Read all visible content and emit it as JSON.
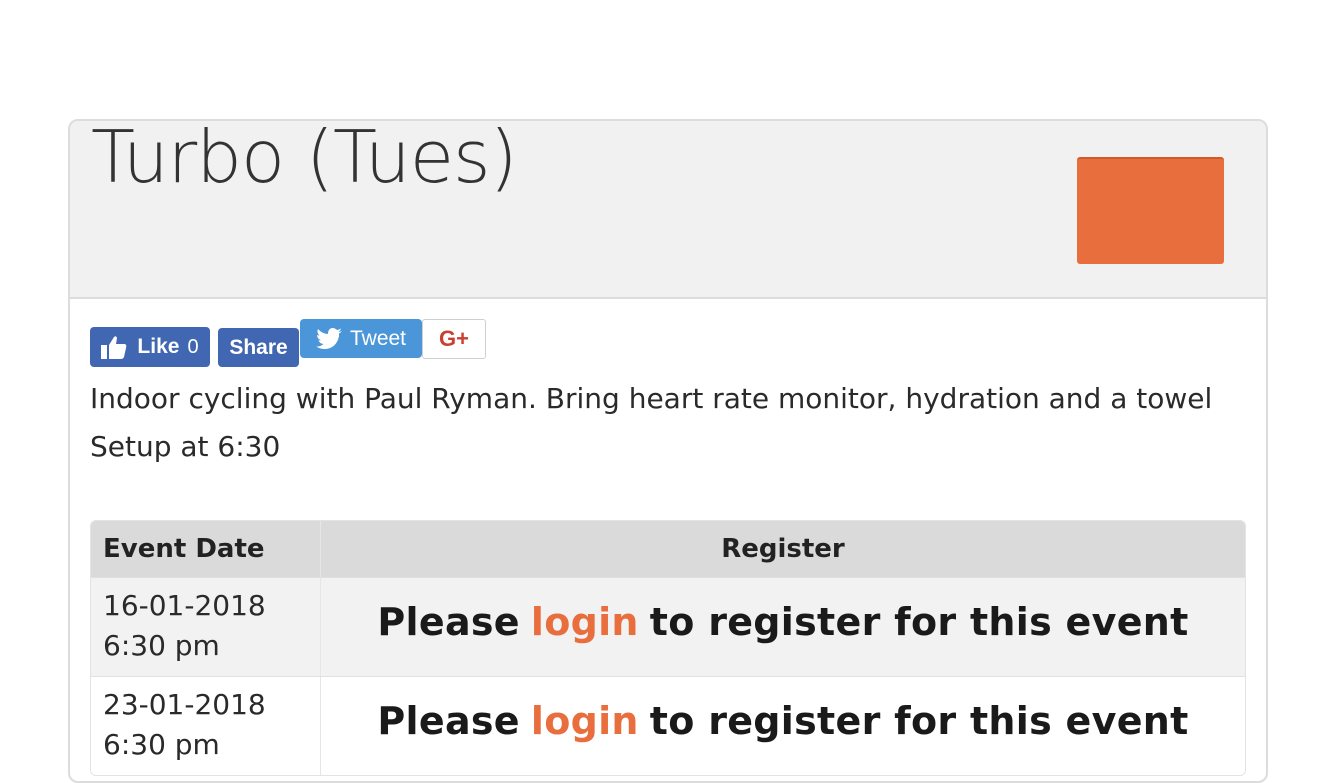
{
  "event": {
    "title": "Turbo (Tues)",
    "description_line1": "Indoor cycling with Paul Ryman. Bring heart rate monitor, hydration and a towel",
    "description_line2": "Setup at 6:30"
  },
  "social": {
    "like_label": "Like",
    "like_count": "0",
    "share_label": "Share",
    "tweet_label": "Tweet",
    "gplus_label": "G+"
  },
  "table": {
    "headers": [
      "Event Date",
      "Register"
    ],
    "rows": [
      {
        "date": "16-01-2018",
        "time": "6:30 pm",
        "register_prefix": "Please",
        "register_link": "login",
        "register_suffix": "to register for this event"
      },
      {
        "date": "23-01-2018",
        "time": "6:30 pm",
        "register_prefix": "Please",
        "register_link": "login",
        "register_suffix": "to register for this event"
      }
    ]
  },
  "colors": {
    "accent": "#e96e3e",
    "facebook": "#4267b2",
    "twitter": "#4a96d9",
    "header_bg": "#f1f1f1"
  }
}
